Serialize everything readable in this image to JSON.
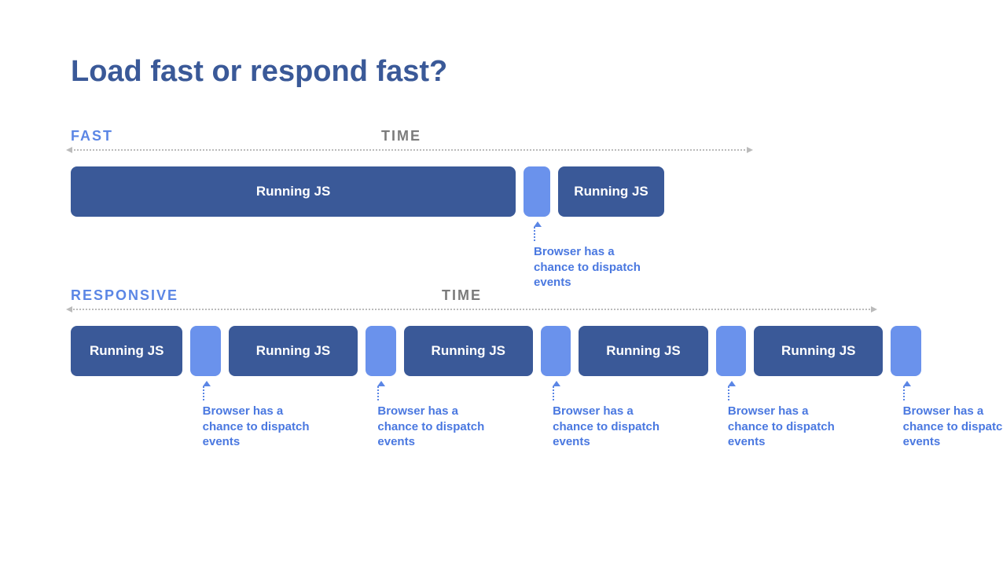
{
  "title": "Load fast or respond fast?",
  "labels": {
    "fast": "FAST",
    "responsive": "RESPONSIVE",
    "time": "TIME",
    "running_js": "Running JS",
    "annotation": "Browser has a chance to dispatch events"
  },
  "colors": {
    "title": "#3a5998",
    "section_label": "#5b86e5",
    "time_label": "#7b7b7b",
    "js_block": "#3a5998",
    "gap_block": "#6a92ec",
    "annotation_text": "#4a78e0"
  },
  "timelines": {
    "fast": {
      "blocks": [
        {
          "type": "js",
          "flex": 67
        },
        {
          "type": "gap",
          "flex": 4,
          "annotated": true
        },
        {
          "type": "js",
          "flex": 16
        }
      ]
    },
    "responsive": {
      "blocks": [
        {
          "type": "js",
          "flex": 13
        },
        {
          "type": "gap",
          "flex": 3.5,
          "annotated": true
        },
        {
          "type": "js",
          "flex": 15
        },
        {
          "type": "gap",
          "flex": 3.5,
          "annotated": true
        },
        {
          "type": "js",
          "flex": 15
        },
        {
          "type": "gap",
          "flex": 3.5,
          "annotated": true
        },
        {
          "type": "js",
          "flex": 15
        },
        {
          "type": "gap",
          "flex": 3.5,
          "annotated": true
        },
        {
          "type": "js",
          "flex": 15
        },
        {
          "type": "gap",
          "flex": 3.5,
          "annotated": true
        }
      ]
    }
  }
}
